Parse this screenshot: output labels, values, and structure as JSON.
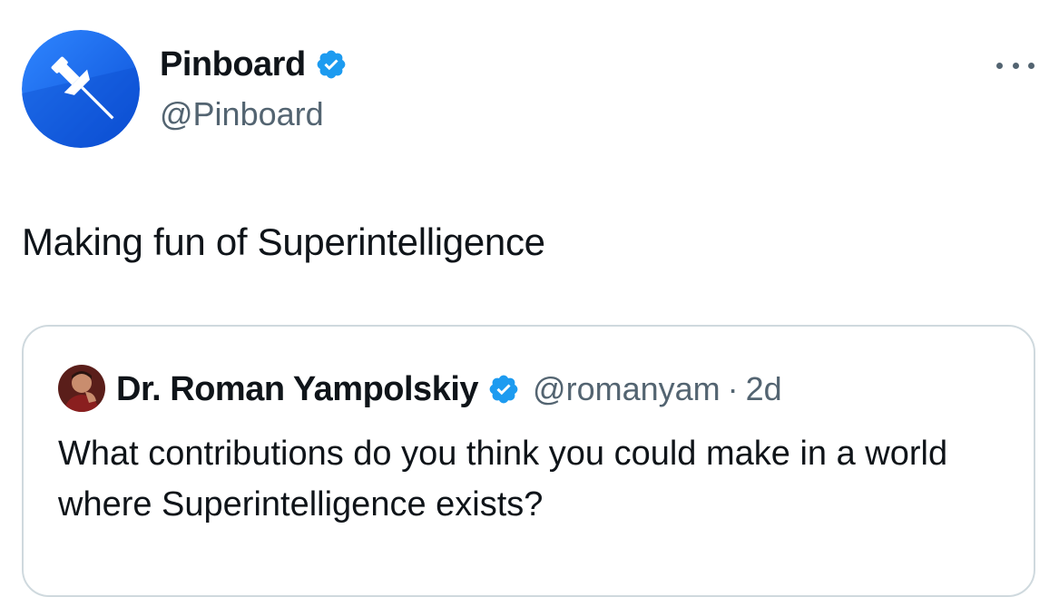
{
  "author": {
    "display_name": "Pinboard",
    "handle": "@Pinboard",
    "verified": true,
    "avatar_icon": "pushpin-icon",
    "avatar_color": "#1d6ff2"
  },
  "tweet": {
    "text": "Making fun of Superintelligence"
  },
  "more_icon": "more-horizontal-icon",
  "quoted_tweet": {
    "display_name": "Dr. Roman Yampolskiy",
    "handle": "@romanyam",
    "separator": "·",
    "time": "2d",
    "verified": true,
    "text": "What contributions do you think you could make in a world where Superintelligence exists?"
  },
  "colors": {
    "verified_badge": "#1d9bf0",
    "text_primary": "#0f1419",
    "text_secondary": "#536471",
    "border": "#cfd9de"
  }
}
